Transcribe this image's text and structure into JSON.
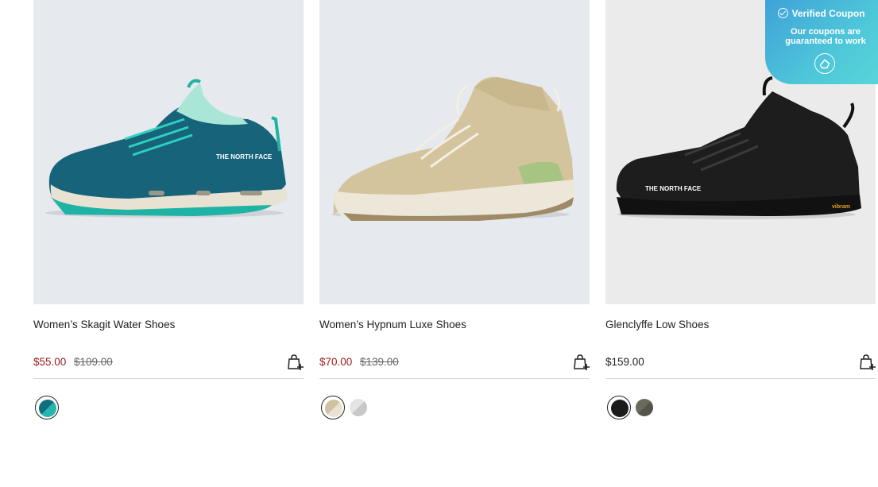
{
  "products": [
    {
      "name": "Women’s Skagit Water Shoes",
      "sale_price": "$55.00",
      "original_price": "$109.00",
      "image_alt": "teal water shoe",
      "swatches": [
        {
          "colors": [
            "#0f6f7c",
            "#27b5b0"
          ],
          "selected": true
        }
      ]
    },
    {
      "name": "Women’s Hypnum Luxe Shoes",
      "sale_price": "$70.00",
      "original_price": "$139.00",
      "image_alt": "beige knit shoe",
      "swatches": [
        {
          "colors": [
            "#cfc2a0",
            "#e8e2d3"
          ],
          "selected": true
        },
        {
          "colors": [
            "#e4e4e4",
            "#c8c8c8"
          ],
          "selected": false
        }
      ]
    },
    {
      "name": "Glenclyffe Low Shoes",
      "price": "$159.00",
      "image_alt": "black low shoe",
      "swatches": [
        {
          "colors": [
            "#1b1b1b",
            "#2a2a2a"
          ],
          "selected": true
        },
        {
          "colors": [
            "#6b6a5c",
            "#55544a"
          ],
          "selected": false
        }
      ]
    }
  ],
  "coupon": {
    "title": "Verified Coupon",
    "subtitle_line1": "Our coupons are",
    "subtitle_line2": "guaranteed to work"
  },
  "icons": {
    "bag": "add-to-bag-icon",
    "check": "check-circle-icon",
    "logo": "coupon-logo-icon"
  }
}
